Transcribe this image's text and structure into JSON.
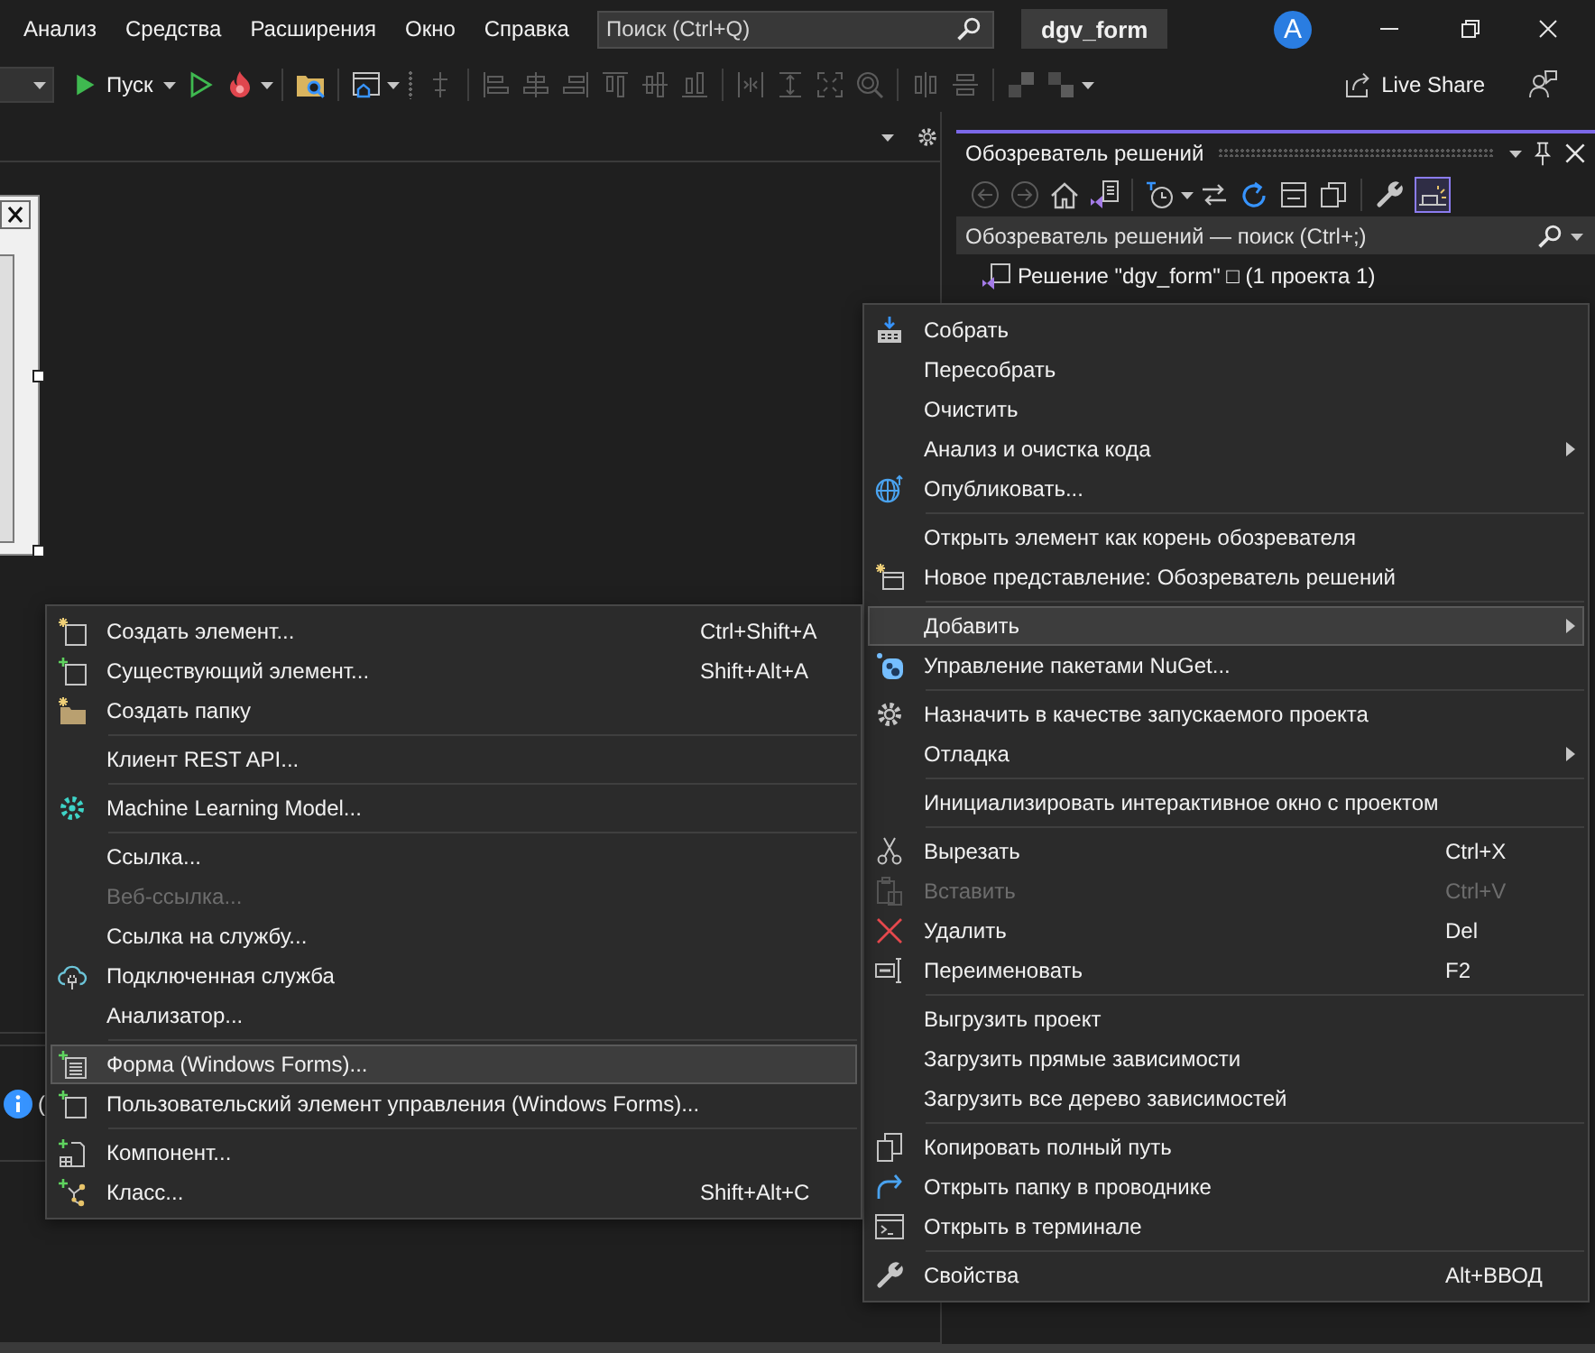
{
  "menu_bar": {
    "items": [
      "Анализ",
      "Средства",
      "Расширения",
      "Окно",
      "Справка"
    ],
    "search": {
      "placeholder": "Поиск (Ctrl+Q)"
    },
    "solution_name": "dgv_form",
    "account_initial": "A"
  },
  "toolbar": {
    "run_label": "Пуск",
    "layout_groups": [
      {
        "buttons": [
          {
            "kind": "snap-grid",
            "disabled": true
          }
        ]
      },
      {
        "buttons": [
          {
            "kind": "align-left",
            "disabled": true
          },
          {
            "kind": "align-center",
            "disabled": true
          },
          {
            "kind": "align-right",
            "disabled": true
          },
          {
            "kind": "align-top",
            "disabled": true
          },
          {
            "kind": "align-middle",
            "disabled": true
          },
          {
            "kind": "align-bottom",
            "disabled": true
          }
        ]
      },
      {
        "buttons": [
          {
            "kind": "center-horizontal",
            "disabled": true
          },
          {
            "kind": "same-height",
            "disabled": true
          },
          {
            "kind": "size-to-grid",
            "disabled": true
          },
          {
            "kind": "zoom",
            "disabled": true
          }
        ]
      },
      {
        "buttons": [
          {
            "kind": "space-horizontal",
            "disabled": true
          },
          {
            "kind": "space-vertical",
            "disabled": true
          }
        ]
      },
      {
        "buttons": [
          {
            "kind": "bring-to-front",
            "disabled": true
          },
          {
            "kind": "send-to-back",
            "disabled": true
          }
        ]
      }
    ],
    "live_share": "Live Share"
  },
  "solution_explorer": {
    "title": "Обозреватель решений",
    "nav_buttons": [
      {
        "kind": "back",
        "disabled": true
      },
      {
        "kind": "forward",
        "disabled": true
      }
    ],
    "preview_toggle": {
      "on": true
    },
    "search": {
      "placeholder": "Обозреватель решений — поиск (Ctrl+;)"
    },
    "tree": [
      {
        "label": "Решение \"dgv_form\" □ (1 проекта 1)"
      }
    ]
  },
  "output_panel": {
    "rows": [
      {
        "kind": "info",
        "text": "("
      }
    ]
  },
  "context_menu": {
    "sections": [
      {
        "items": [
          {
            "label": "Собрать",
            "submenu": false,
            "disabled": false,
            "selected": false
          },
          {
            "label": "Пересобрать",
            "submenu": false,
            "disabled": false,
            "selected": false
          },
          {
            "label": "Очистить",
            "submenu": false,
            "disabled": false,
            "selected": false
          },
          {
            "label": "Анализ и очистка кода",
            "submenu": true,
            "disabled": false,
            "selected": false
          },
          {
            "label": "Опубликовать...",
            "submenu": false,
            "disabled": false,
            "selected": false
          }
        ]
      },
      {
        "items": [
          {
            "label": "Открыть элемент как корень обозревателя",
            "submenu": false,
            "disabled": false,
            "selected": false
          },
          {
            "label": "Новое представление: Обозреватель решений",
            "submenu": false,
            "disabled": false,
            "selected": false
          }
        ]
      },
      {
        "items": [
          {
            "label": "Добавить",
            "submenu": true,
            "disabled": false,
            "selected": true
          },
          {
            "label": "Управление пакетами NuGet...",
            "submenu": false,
            "disabled": false,
            "selected": false
          }
        ]
      },
      {
        "items": [
          {
            "label": "Назначить в качестве запускаемого проекта",
            "submenu": false,
            "disabled": false,
            "selected": false
          },
          {
            "label": "Отладка",
            "submenu": true,
            "disabled": false,
            "selected": false
          }
        ]
      },
      {
        "items": [
          {
            "label": "Инициализировать интерактивное окно с проектом",
            "submenu": false,
            "disabled": false,
            "selected": false
          }
        ]
      },
      {
        "items": [
          {
            "label": "Вырезать",
            "shortcut": "Ctrl+X",
            "submenu": false,
            "disabled": false,
            "selected": false
          },
          {
            "label": "Вставить",
            "shortcut": "Ctrl+V",
            "submenu": false,
            "disabled": true,
            "selected": false
          },
          {
            "label": "Удалить",
            "shortcut": "Del",
            "submenu": false,
            "disabled": false,
            "selected": false
          },
          {
            "label": "Переименовать",
            "shortcut": "F2",
            "submenu": false,
            "disabled": false,
            "selected": false
          }
        ]
      },
      {
        "items": [
          {
            "label": "Выгрузить проект",
            "submenu": false,
            "disabled": false,
            "selected": false
          },
          {
            "label": "Загрузить прямые зависимости",
            "submenu": false,
            "disabled": false,
            "selected": false
          },
          {
            "label": "Загрузить все дерево зависимостей",
            "submenu": false,
            "disabled": false,
            "selected": false
          }
        ]
      },
      {
        "items": [
          {
            "label": "Копировать полный путь",
            "submenu": false,
            "disabled": false,
            "selected": false
          },
          {
            "label": "Открыть папку в проводнике",
            "submenu": false,
            "disabled": false,
            "selected": false
          },
          {
            "label": "Открыть в терминале",
            "submenu": false,
            "disabled": false,
            "selected": false
          }
        ]
      },
      {
        "items": [
          {
            "label": "Свойства",
            "shortcut": "Alt+ВВОД",
            "submenu": false,
            "disabled": false,
            "selected": false
          }
        ]
      }
    ]
  },
  "add_submenu": {
    "sections": [
      {
        "items": [
          {
            "label": "Создать элемент...",
            "shortcut": "Ctrl+Shift+A",
            "submenu": false,
            "disabled": false,
            "selected": false
          },
          {
            "label": "Существующий элемент...",
            "shortcut": "Shift+Alt+A",
            "submenu": false,
            "disabled": false,
            "selected": false
          },
          {
            "label": "Создать папку",
            "submenu": false,
            "disabled": false,
            "selected": false
          }
        ]
      },
      {
        "items": [
          {
            "label": "Клиент REST API...",
            "submenu": false,
            "disabled": false,
            "selected": false
          }
        ]
      },
      {
        "items": [
          {
            "label": "Machine Learning Model...",
            "submenu": false,
            "disabled": false,
            "selected": false
          }
        ]
      },
      {
        "items": [
          {
            "label": "Ссылка...",
            "submenu": false,
            "disabled": false,
            "selected": false
          },
          {
            "label": "Веб-ссылка...",
            "submenu": false,
            "disabled": true,
            "selected": false
          },
          {
            "label": "Ссылка на службу...",
            "submenu": false,
            "disabled": false,
            "selected": false
          },
          {
            "label": "Подключенная служба",
            "submenu": false,
            "disabled": false,
            "selected": false
          },
          {
            "label": "Анализатор...",
            "submenu": false,
            "disabled": false,
            "selected": false
          }
        ]
      },
      {
        "items": [
          {
            "label": "Форма (Windows Forms)...",
            "submenu": false,
            "disabled": false,
            "selected": true
          },
          {
            "label": "Пользовательский элемент управления (Windows Forms)...",
            "submenu": false,
            "disabled": false,
            "selected": false
          }
        ]
      },
      {
        "items": [
          {
            "label": "Компонент...",
            "submenu": false,
            "disabled": false,
            "selected": false
          },
          {
            "label": "Класс...",
            "shortcut": "Shift+Alt+C",
            "submenu": false,
            "disabled": false,
            "selected": false
          }
        ]
      }
    ]
  }
}
